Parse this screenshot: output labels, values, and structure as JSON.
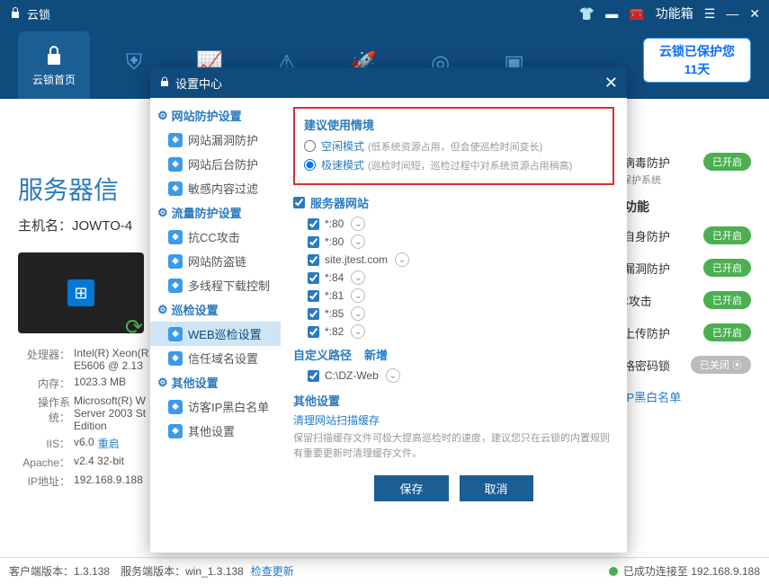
{
  "titlebar": {
    "title": "云锁",
    "toolbox_label": "功能箱"
  },
  "topnav": {
    "home_label": "云锁首页",
    "protect_box_line1": "云锁已保护您",
    "protect_box_line2": "11天"
  },
  "main": {
    "server_info_title": "服务器信",
    "host_label": "主机名：JOWTO-4",
    "info": {
      "cpu_lbl": "处理器：",
      "cpu_val": "Intel(R) Xeon(R\nE5606 @ 2.13",
      "mem_lbl": "内存：",
      "mem_val": "1023.3 MB",
      "os_lbl": "操作系统：",
      "os_val": "Microsoft(R) W\nServer 2003 St\nEdition",
      "iis_lbl": "IIS：",
      "iis_val": "v6.0",
      "restart": "重启",
      "apache_lbl": "Apache：",
      "apache_val": "v2.4 32-bit",
      "ip_lbl": "IP地址：",
      "ip_val": "192.168.9.188"
    }
  },
  "rpanel": {
    "item1_label": "马病毒防护",
    "item1_sub": "建保护系统",
    "heading": "用功能",
    "items": [
      {
        "label": "锁自身防护",
        "badge": "已开启",
        "on": true
      },
      {
        "label": "站漏洞防护",
        "badge": "已开启",
        "on": true
      },
      {
        "label": "CC攻击",
        "badge": "已开启",
        "on": true
      },
      {
        "label": "件上传防护",
        "badge": "已开启",
        "on": true
      },
      {
        "label": "宫格密码锁",
        "badge": "已关闭",
        "on": false
      }
    ],
    "link": "客IP黑白名单"
  },
  "modal": {
    "title": "设置中心",
    "sidebar": {
      "g1": "网站防护设置",
      "g1_items": [
        "网站漏洞防护",
        "网站后台防护",
        "敏感内容过滤"
      ],
      "g2": "流量防护设置",
      "g2_items": [
        "抗CC攻击",
        "网站防盗链",
        "多线程下载控制"
      ],
      "g3": "巡检设置",
      "g3_items": [
        "WEB巡检设置",
        "信任域名设置"
      ],
      "g4": "其他设置",
      "g4_items": [
        "访客IP黑白名单",
        "其他设置"
      ]
    },
    "content": {
      "rec_title": "建议使用情境",
      "radio1_label": "空闲模式",
      "radio1_hint": "(低系统资源占用，但会使巡检时间变长)",
      "radio2_label": "极速模式",
      "radio2_hint": "(巡检时间短，巡检过程中对系统资源占用稍高)",
      "server_sites_title": "服务器网站",
      "sites": [
        "*:80",
        "*:80",
        "site.jtest.com",
        "*:84",
        "*:81",
        "*:85",
        "*:82"
      ],
      "custom_path_title": "自定义路径",
      "add_label": "新增",
      "custom_paths": [
        "C:\\DZ-Web"
      ],
      "other_title": "其他设置",
      "cache_link": "清理网站扫描缓存",
      "cache_desc": "保留扫描缓存文件可极大提高巡检时的速度，建议您只在云锁的内置规则有重要更新时清理缓存文件。",
      "save": "保存",
      "cancel": "取消"
    }
  },
  "statusbar": {
    "client_ver_lbl": "客户端版本：",
    "client_ver": "1.3.138",
    "server_ver_lbl": "服务端版本：",
    "server_ver": "win_1.3.138",
    "check_update": "检查更新",
    "connected": "已成功连接至 192.168.9.188"
  }
}
